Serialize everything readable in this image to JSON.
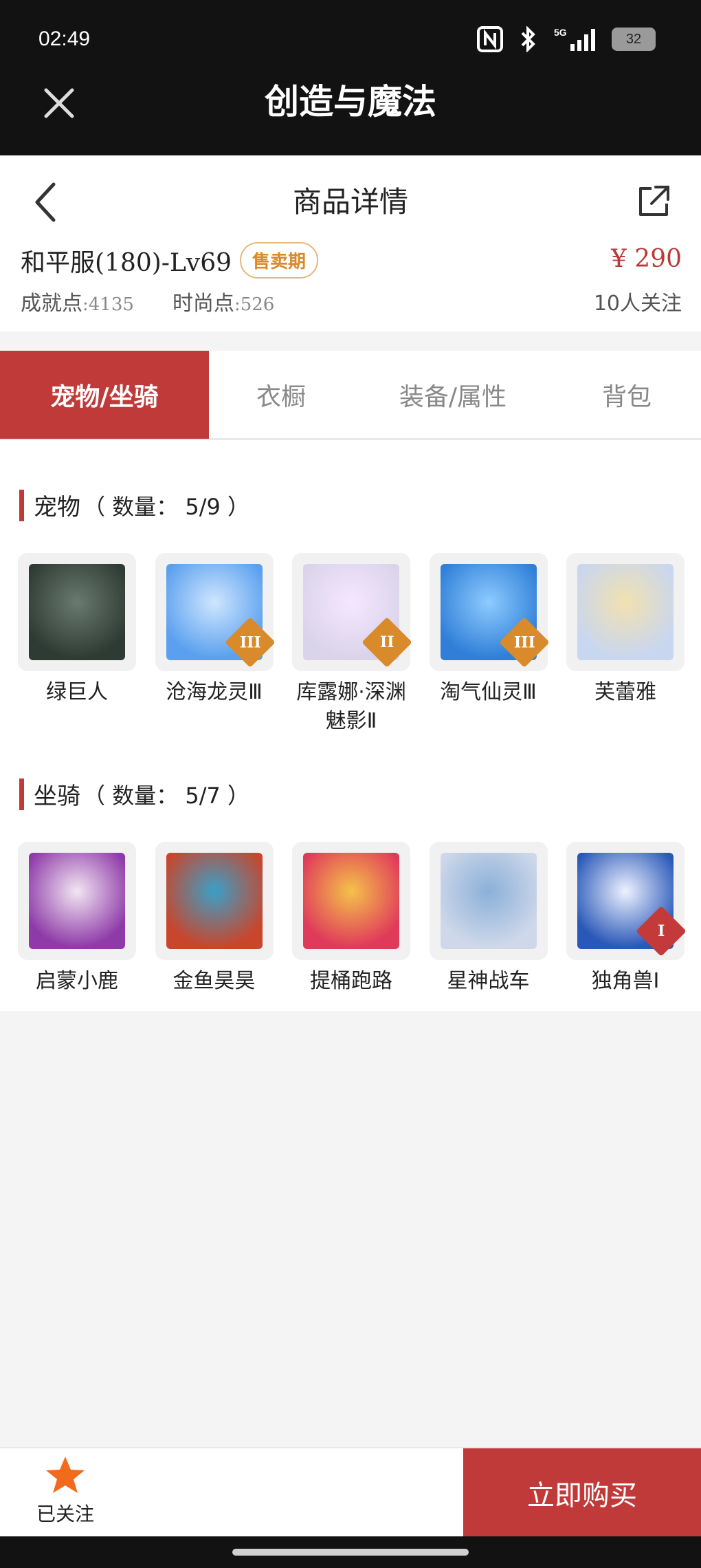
{
  "status_bar": {
    "time": "02:49",
    "battery": "32"
  },
  "app": {
    "title": "创造与魔法"
  },
  "page": {
    "title": "商品详情"
  },
  "product": {
    "server": "和平服(180)-Lv69",
    "badge": "售卖期",
    "price": "¥ 290",
    "achievement_label": "成就点",
    "achievement_value": ":4135",
    "fashion_label": "时尚点",
    "fashion_value": ":526",
    "followers": "10人关注"
  },
  "tabs": [
    {
      "label": "宠物/坐骑",
      "active": true
    },
    {
      "label": "衣橱",
      "active": false
    },
    {
      "label": "装备/属性",
      "active": false
    },
    {
      "label": "背包",
      "active": false
    }
  ],
  "pets": {
    "title": "宠物",
    "count": "（ 数量： 5/9 ）",
    "items": [
      {
        "name": "绿巨人",
        "rank": "",
        "rank_color": "",
        "art": [
          "#2e3b34",
          "#6a7a70"
        ]
      },
      {
        "name": "沧海龙灵Ⅲ",
        "rank": "III",
        "rank_color": "#d98a2a",
        "art": [
          "#5aa0ee",
          "#cfe6ff"
        ]
      },
      {
        "name": "库露娜·深渊魅影Ⅱ",
        "rank": "II",
        "rank_color": "#d98a2a",
        "art": [
          "#d9d4ea",
          "#f6e6ff"
        ]
      },
      {
        "name": "淘气仙灵Ⅲ",
        "rank": "III",
        "rank_color": "#d98a2a",
        "art": [
          "#2f7fd8",
          "#8ecbff"
        ]
      },
      {
        "name": "芙蕾雅",
        "rank": "",
        "rank_color": "",
        "art": [
          "#c8d6f0",
          "#f2e1b0"
        ]
      }
    ]
  },
  "mounts": {
    "title": "坐骑",
    "count": "（ 数量： 5/7 ）",
    "items": [
      {
        "name": "启蒙小鹿",
        "rank": "",
        "rank_color": "",
        "art": [
          "#8e3aa8",
          "#f2e6f2"
        ]
      },
      {
        "name": "金鱼昊昊",
        "rank": "",
        "rank_color": "",
        "art": [
          "#c8462c",
          "#3aa0c8"
        ]
      },
      {
        "name": "提桶跑路",
        "rank": "",
        "rank_color": "",
        "art": [
          "#e03a5a",
          "#f4c24a"
        ]
      },
      {
        "name": "星神战车",
        "rank": "",
        "rank_color": "",
        "art": [
          "#cfd8ea",
          "#8ab0d8"
        ]
      },
      {
        "name": "独角兽Ⅰ",
        "rank": "I",
        "rank_color": "#c43a3a",
        "art": [
          "#2a58b8",
          "#eef2ff"
        ]
      }
    ]
  },
  "bottom": {
    "follow_label": "已关注",
    "buy_label": "立即购买"
  },
  "colors": {
    "accent": "#c13a3a",
    "badge": "#d98a2a",
    "star": "#f26a1b"
  },
  "icons": [
    "close-icon",
    "back-icon",
    "share-icon",
    "star-icon",
    "nfc-icon",
    "bluetooth-icon",
    "signal-icon",
    "battery-icon"
  ]
}
